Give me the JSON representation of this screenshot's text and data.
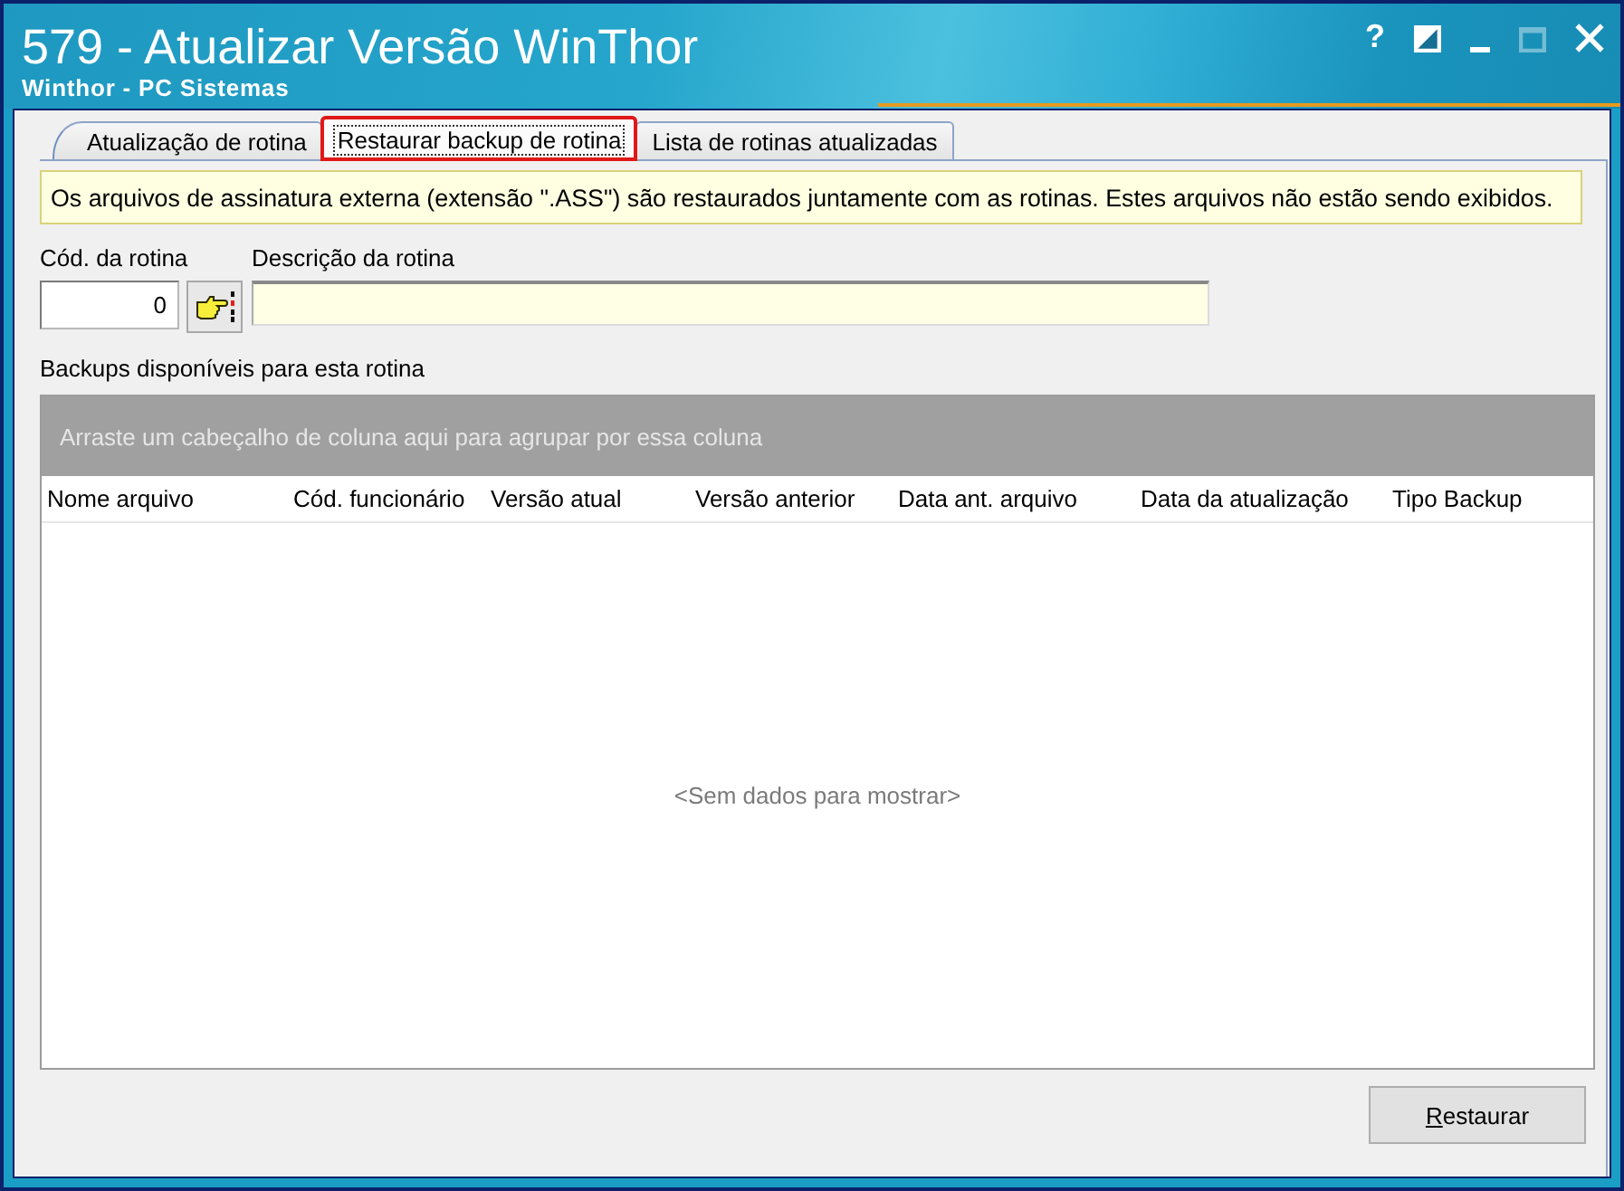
{
  "window": {
    "title": "579 - Atualizar Versão WinThor",
    "subtitle": "Winthor - PC Sistemas",
    "controls": [
      {
        "kind": "help",
        "label": "?",
        "disabled": false
      },
      {
        "kind": "theme",
        "disabled": false
      },
      {
        "kind": "minimize",
        "disabled": false
      },
      {
        "kind": "maximize",
        "disabled": true
      },
      {
        "kind": "close",
        "disabled": false
      }
    ]
  },
  "tabs": [
    {
      "label": "Atualização de rotina",
      "selected": false,
      "focused": false,
      "highlighted": false
    },
    {
      "label": "Restaurar backup de rotina",
      "selected": true,
      "focused": true,
      "highlighted": true
    },
    {
      "label": "Lista de rotinas atualizadas",
      "selected": false,
      "focused": false,
      "highlighted": false
    }
  ],
  "notice": "Os arquivos de assinatura externa (extensão \".ASS\") são restaurados juntamente com as rotinas. Estes arquivos não estão sendo exibidos.",
  "fields": {
    "code": {
      "label": "Cód. da rotina",
      "value": "0"
    },
    "description": {
      "label": "Descrição da rotina"
    }
  },
  "backups": {
    "label": "Backups disponíveis para esta rotina",
    "group_hint": "Arraste um cabeçalho de coluna aqui para agrupar por essa coluna",
    "columns": [
      "Nome arquivo",
      "Cód. funcionário",
      "Versão atual",
      "Versão anterior",
      "Data ant. arquivo",
      "Data da atualização",
      "Tipo Backup"
    ],
    "empty_text": "<Sem dados para mostrar>"
  },
  "buttons": [
    {
      "label": "Restaurar",
      "mnemonic": true
    }
  ]
}
